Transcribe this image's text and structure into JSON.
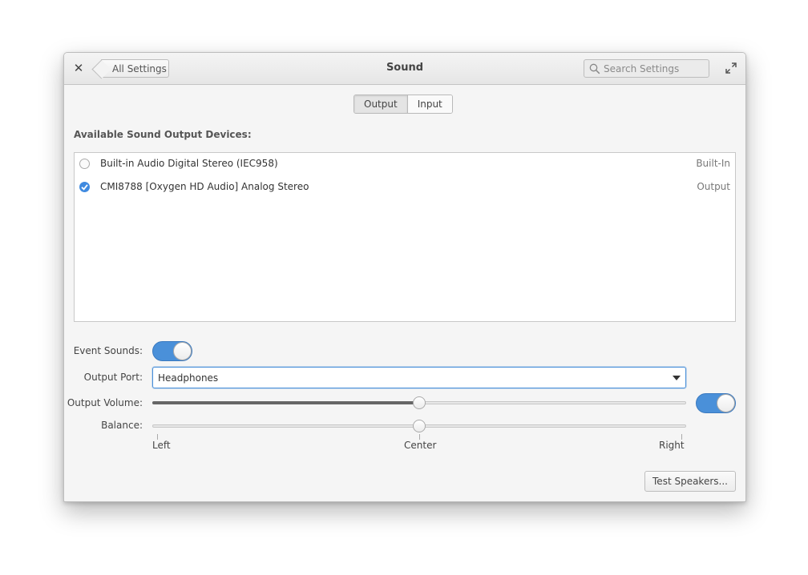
{
  "header": {
    "back_label": "All Settings",
    "title": "Sound",
    "search_placeholder": "Search Settings"
  },
  "tabs": [
    {
      "label": "Output",
      "active": true
    },
    {
      "label": "Input",
      "active": false
    }
  ],
  "devices": {
    "section_title": "Available Sound Output Devices:",
    "items": [
      {
        "name": "Built-in Audio Digital Stereo (IEC958)",
        "description": "Built-In",
        "selected": false
      },
      {
        "name": "CMI8788 [Oxygen HD Audio] Analog Stereo",
        "description": "Output",
        "selected": true
      }
    ]
  },
  "settings": {
    "event_sounds_label": "Event Sounds:",
    "event_sounds_on": true,
    "output_port_label": "Output Port:",
    "output_port_value": "Headphones",
    "output_volume_label": "Output Volume:",
    "output_volume": 0.5,
    "output_enabled": true,
    "balance_label": "Balance:",
    "balance": 0.5,
    "balance_marks": {
      "left": "Left",
      "center": "Center",
      "right": "Right"
    }
  },
  "actions": {
    "test_speakers_label": "Test Speakers..."
  },
  "colors": {
    "accent": "#4a90d9",
    "window_bg": "#f5f5f5"
  }
}
